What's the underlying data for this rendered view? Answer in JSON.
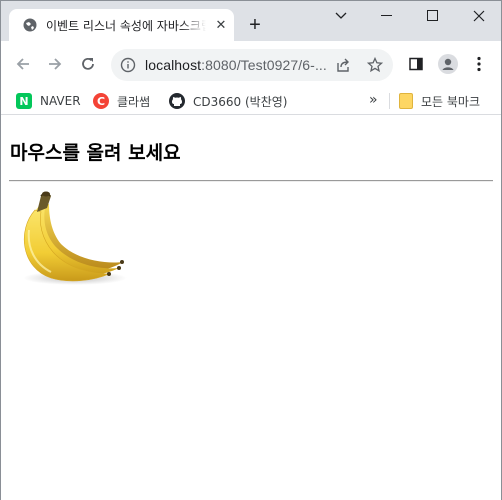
{
  "browser": {
    "tab": {
      "title": "이벤트 리스너 속성에 자바스크립트",
      "close_symbol": "✕",
      "favicon": "globe-icon"
    },
    "new_tab_symbol": "+",
    "window_controls": [
      "chevron-down-icon",
      "minimize-icon",
      "maximize-icon",
      "close-icon"
    ],
    "toolbar": {
      "url_host": "localhost",
      "url_rest": ":8080/Test0927/6-...",
      "icons": [
        "back-icon",
        "forward-icon",
        "reload-icon",
        "info-icon",
        "share-icon",
        "star-icon",
        "sidepanel-icon",
        "profile-icon",
        "menu-icon"
      ]
    },
    "bookmarks": {
      "items": [
        {
          "label": "NAVER",
          "icon": "naver-icon",
          "color": "#03c75a",
          "glyph": "N"
        },
        {
          "label": "클라썸",
          "icon": "classum-icon",
          "color": "#f44336",
          "glyph": "C"
        },
        {
          "label": "CD3660 (박찬영)",
          "icon": "github-icon",
          "color": "#24292f",
          "glyph": ""
        }
      ],
      "overflow": "»",
      "all_bookmarks": "모든 북마크"
    }
  },
  "page": {
    "heading": "마우스를 올려 보세요",
    "image": "banana-image"
  },
  "colors": {
    "tabstrip": "#dee1e6",
    "omnibox": "#f1f3f4",
    "banana": "#f2d13f"
  }
}
